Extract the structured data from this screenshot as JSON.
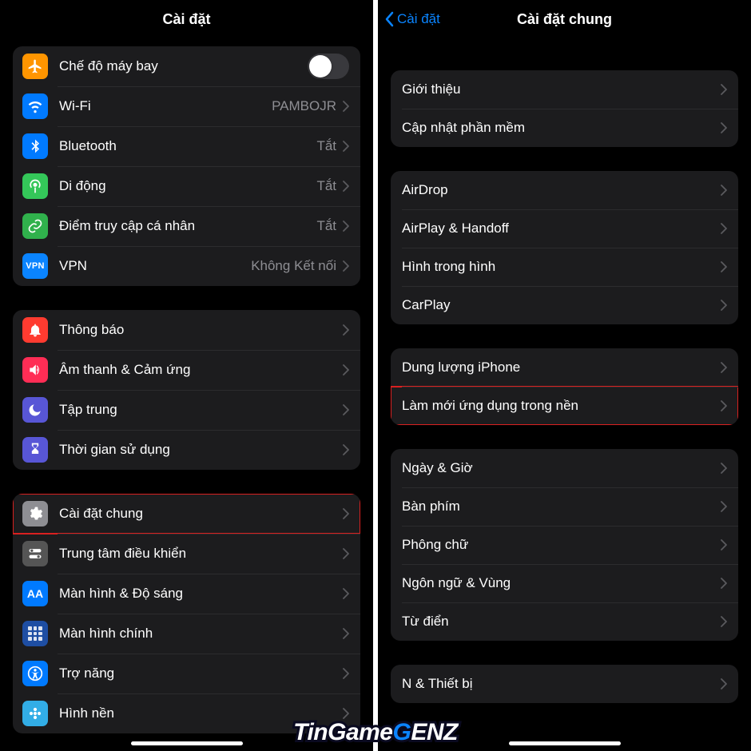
{
  "left": {
    "title": "Cài đặt",
    "groups": [
      {
        "first": true,
        "rows": [
          {
            "name": "airplane-mode-row",
            "icon": "airplane-icon",
            "iconBg": "bg-orange",
            "label": "Chế độ máy bay",
            "control": "toggle"
          },
          {
            "name": "wifi-row",
            "icon": "wifi-icon",
            "iconBg": "bg-blue",
            "label": "Wi-Fi",
            "value": "PAMBOJR",
            "control": "chevron"
          },
          {
            "name": "bluetooth-row",
            "icon": "bluetooth-icon",
            "iconBg": "bg-blue",
            "label": "Bluetooth",
            "value": "Tắt",
            "control": "chevron"
          },
          {
            "name": "cellular-row",
            "icon": "antenna-icon",
            "iconBg": "bg-green",
            "label": "Di động",
            "value": "Tắt",
            "control": "chevron"
          },
          {
            "name": "hotspot-row",
            "icon": "link-icon",
            "iconBg": "bg-greendk",
            "label": "Điểm truy cập cá nhân",
            "value": "Tắt",
            "control": "chevron"
          },
          {
            "name": "vpn-row",
            "icon": "vpn-icon",
            "iconBg": "bg-blue2",
            "label": "VPN",
            "value": "Không Kết nối",
            "control": "chevron"
          }
        ]
      },
      {
        "rows": [
          {
            "name": "notifications-row",
            "icon": "bell-icon",
            "iconBg": "bg-red",
            "label": "Thông báo",
            "control": "chevron"
          },
          {
            "name": "sounds-row",
            "icon": "speaker-icon",
            "iconBg": "bg-pink",
            "label": "Âm thanh & Cảm ứng",
            "control": "chevron"
          },
          {
            "name": "focus-row",
            "icon": "moon-icon",
            "iconBg": "bg-indigo",
            "label": "Tập trung",
            "control": "chevron"
          },
          {
            "name": "screentime-row",
            "icon": "hourglass-icon",
            "iconBg": "bg-indigo",
            "label": "Thời gian sử dụng",
            "control": "chevron"
          }
        ]
      },
      {
        "rows": [
          {
            "name": "general-row",
            "icon": "gear-icon",
            "iconBg": "bg-gray",
            "label": "Cài đặt chung",
            "control": "chevron",
            "highlight": true
          },
          {
            "name": "control-center-row",
            "icon": "switches-icon",
            "iconBg": "bg-darkgray",
            "label": "Trung tâm điều khiển",
            "control": "chevron"
          },
          {
            "name": "display-row",
            "icon": "aa-icon",
            "iconBg": "bg-blue",
            "label": "Màn hình & Độ sáng",
            "control": "chevron"
          },
          {
            "name": "homescreen-row",
            "icon": "grid-icon",
            "iconBg": "bg-navy",
            "label": "Màn hình chính",
            "control": "chevron"
          },
          {
            "name": "accessibility-row",
            "icon": "accessibility-icon",
            "iconBg": "bg-blue",
            "label": "Trợ năng",
            "control": "chevron"
          },
          {
            "name": "wallpaper-row",
            "icon": "flower-icon",
            "iconBg": "bg-cyan",
            "label": "Hình nền",
            "control": "chevron"
          }
        ]
      }
    ]
  },
  "right": {
    "back": "Cài đặt",
    "title": "Cài đặt chung",
    "groups": [
      {
        "rows": [
          {
            "name": "about-row",
            "label": "Giới thiệu",
            "control": "chevron"
          },
          {
            "name": "software-update-row",
            "label": "Cập nhật phần mềm",
            "control": "chevron"
          }
        ]
      },
      {
        "rows": [
          {
            "name": "airdrop-row",
            "label": "AirDrop",
            "control": "chevron"
          },
          {
            "name": "airplay-row",
            "label": "AirPlay & Handoff",
            "control": "chevron"
          },
          {
            "name": "pip-row",
            "label": "Hình trong hình",
            "control": "chevron"
          },
          {
            "name": "carplay-row",
            "label": "CarPlay",
            "control": "chevron"
          }
        ]
      },
      {
        "rows": [
          {
            "name": "storage-row",
            "label": "Dung lượng iPhone",
            "control": "chevron"
          },
          {
            "name": "background-refresh-row",
            "label": "Làm mới ứng dụng trong nền",
            "control": "chevron",
            "highlight": true
          }
        ]
      },
      {
        "rows": [
          {
            "name": "date-time-row",
            "label": "Ngày & Giờ",
            "control": "chevron"
          },
          {
            "name": "keyboard-row",
            "label": "Bàn phím",
            "control": "chevron"
          },
          {
            "name": "fonts-row",
            "label": "Phông chữ",
            "control": "chevron"
          },
          {
            "name": "language-region-row",
            "label": "Ngôn ngữ & Vùng",
            "control": "chevron"
          },
          {
            "name": "dictionary-row",
            "label": "Từ điển",
            "control": "chevron"
          }
        ]
      },
      {
        "rows": [
          {
            "name": "vpn-device-row",
            "label": "N & Thiết bị",
            "control": "chevron"
          }
        ]
      }
    ]
  },
  "watermark": {
    "a": "TinGame",
    "b": "G",
    "c": "ENZ"
  }
}
